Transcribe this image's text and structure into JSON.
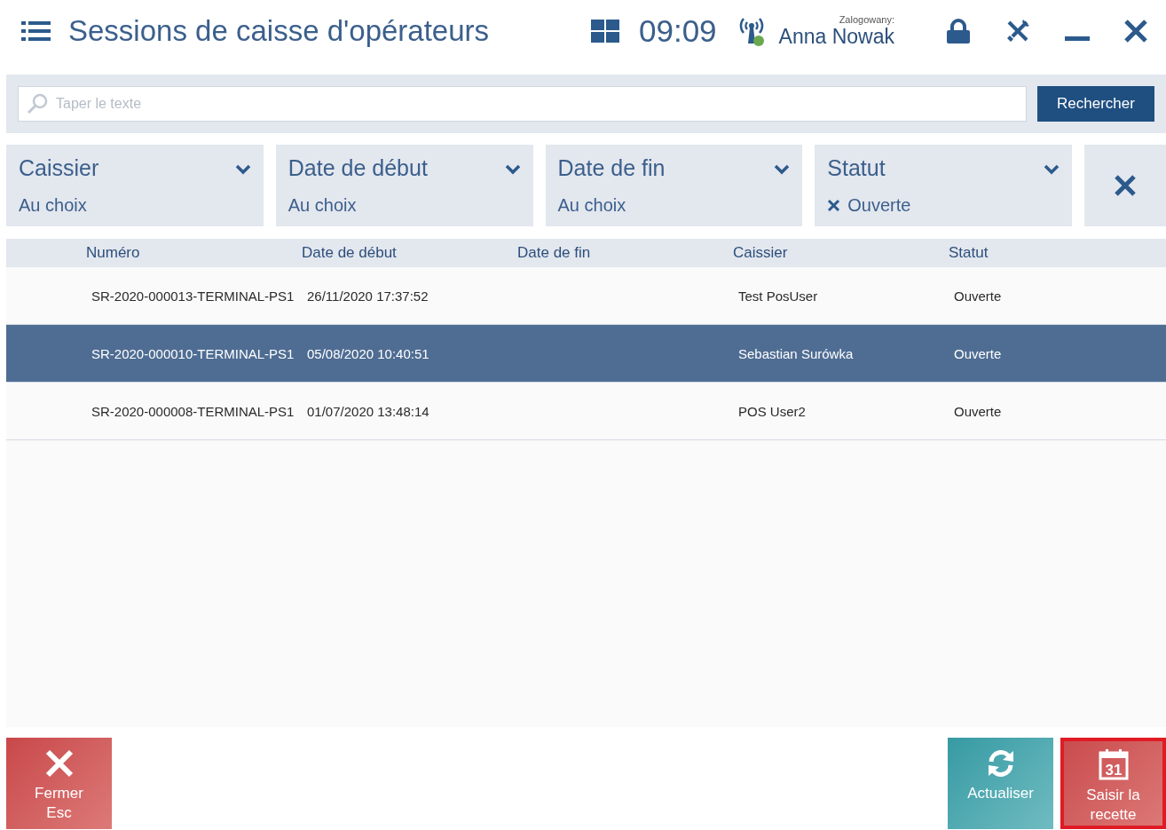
{
  "header": {
    "title": "Sessions de caisse d'opérateurs",
    "time": "09:09",
    "user_label": "Zalogowany:",
    "user_name": "Anna Nowak",
    "connected": true
  },
  "search": {
    "placeholder": "Taper le texte",
    "button": "Rechercher"
  },
  "filters": [
    {
      "label": "Caissier",
      "value": "Au choix",
      "removable": false
    },
    {
      "label": "Date de début",
      "value": "Au choix",
      "removable": false
    },
    {
      "label": "Date de fin",
      "value": "Au choix",
      "removable": false
    },
    {
      "label": "Statut",
      "value": "Ouverte",
      "removable": true
    }
  ],
  "table": {
    "columns": [
      "Numéro",
      "Date de début",
      "Date de fin",
      "Caissier",
      "Statut"
    ],
    "rows": [
      {
        "cells": [
          "SR-2020-000013-TERMINAL-PS1",
          "26/11/2020 17:37:52",
          "",
          "Test PosUser",
          "Ouverte"
        ],
        "selected": false
      },
      {
        "cells": [
          "SR-2020-000010-TERMINAL-PS1",
          "05/08/2020 10:40:51",
          "",
          "Sebastian Surówka",
          "Ouverte"
        ],
        "selected": true
      },
      {
        "cells": [
          "SR-2020-000008-TERMINAL-PS1",
          "01/07/2020 13:48:14",
          "",
          "POS User2",
          "Ouverte"
        ],
        "selected": false
      }
    ]
  },
  "actions": [
    {
      "kind": "close",
      "lines": [
        "Fermer",
        "Esc"
      ],
      "highlighted": false
    },
    {
      "kind": "refresh",
      "lines": [
        "Actualiser"
      ],
      "highlighted": false
    },
    {
      "kind": "calendar",
      "lines": [
        "Saisir la",
        "recette"
      ],
      "icon_text": "31",
      "highlighted": true
    }
  ]
}
